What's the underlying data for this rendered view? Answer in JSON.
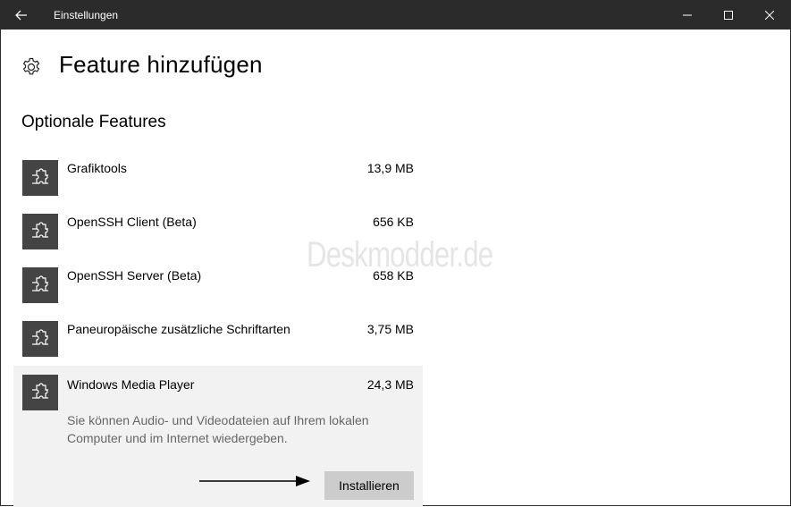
{
  "window": {
    "title": "Einstellungen"
  },
  "page": {
    "title": "Feature hinzufügen",
    "section_title": "Optionale Features"
  },
  "features": [
    {
      "name": "Grafiktools",
      "size": "13,9 MB"
    },
    {
      "name": "OpenSSH Client (Beta)",
      "size": "656 KB"
    },
    {
      "name": "OpenSSH Server (Beta)",
      "size": "658 KB"
    },
    {
      "name": "Paneuropäische zusätzliche Schriftarten",
      "size": "3,75 MB"
    },
    {
      "name": "Windows Media Player",
      "size": "24,3 MB",
      "description": "Sie können Audio- und Videodateien auf Ihrem lokalen Computer und im Internet wiedergeben.",
      "install_label": "Installieren"
    }
  ],
  "watermark": "Deskmodder.de",
  "icons": {
    "back": "back-arrow-icon",
    "minimize": "minimize-icon",
    "maximize": "maximize-icon",
    "close": "close-icon",
    "settings": "gear-icon",
    "feature": "puzzle-piece-icon"
  },
  "colors": {
    "titlebar": "#2b2b2b",
    "feature_icon_bg": "#444444",
    "expanded_bg": "#f2f2f2",
    "button_bg": "#cccccc",
    "description_text": "#666666"
  }
}
